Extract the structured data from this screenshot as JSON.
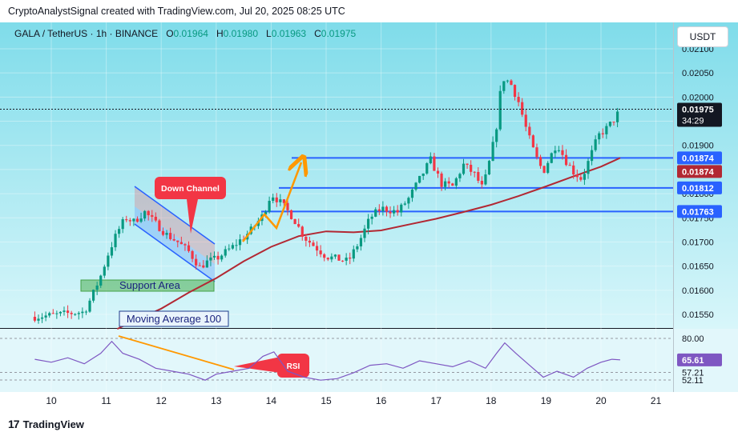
{
  "header": {
    "attribution": "CryptoAnalystSignal created with TradingView.com, Jul 20, 2025 08:25 UTC"
  },
  "legend": {
    "symbol": "GALA / TetherUS · 1h · BINANCE",
    "open_label": "O",
    "open": "0.01964",
    "high_label": "H",
    "high": "0.01980",
    "low_label": "L",
    "low": "0.01963",
    "close_label": "C",
    "close": "0.01975"
  },
  "currency_button": "USDT",
  "footer": {
    "brand": "TradingView"
  },
  "colors": {
    "up": "#089981",
    "down": "#f23645",
    "ma": "#b22833",
    "level_line": "#2962ff",
    "rsi": "#7e57c2",
    "annotation_orange": "#ff9800",
    "bg_top": "#7fdcea",
    "bg_bottom": "#d8f6fa"
  },
  "annotations": {
    "down_channel": "Down Channel",
    "support_area": "Support Area",
    "moving_average": "Moving Average 100",
    "rsi": "RSI"
  },
  "chart_data": [
    {
      "type": "candlestick",
      "title": "GALA / TetherUS · 1h · BINANCE",
      "x_axis": {
        "labels": [
          "10",
          "11",
          "12",
          "13",
          "14",
          "15",
          "16",
          "17",
          "18",
          "19",
          "20",
          "21"
        ],
        "unit": "day of July 2025"
      },
      "y_axis": {
        "range": [
          0.0152,
          0.0211
        ],
        "tick_labels": [
          "0.02100",
          "0.02050",
          "0.02000",
          "0.01950",
          "0.01900",
          "0.01850",
          "0.01800",
          "0.01750",
          "0.01700",
          "0.01650",
          "0.01600",
          "0.01550"
        ]
      },
      "price_labels": [
        {
          "value": "0.01975",
          "note": "last price",
          "countdown": "34:29"
        },
        {
          "value": "0.01874",
          "note": "resistance line"
        },
        {
          "value": "0.01874",
          "note": "moving average 100"
        },
        {
          "value": "0.01812",
          "note": "horizontal level"
        },
        {
          "value": "0.01763",
          "note": "horizontal level"
        }
      ],
      "levels": [
        0.01874,
        0.01812,
        0.01763
      ],
      "series": [
        {
          "name": "Moving Average 100",
          "points": [
            {
              "x": 11.2,
              "y": 0.0152
            },
            {
              "x": 12.0,
              "y": 0.01562
            },
            {
              "x": 12.5,
              "y": 0.01595
            },
            {
              "x": 13.0,
              "y": 0.01625
            },
            {
              "x": 13.5,
              "y": 0.0166
            },
            {
              "x": 14.0,
              "y": 0.0169
            },
            {
              "x": 14.5,
              "y": 0.01712
            },
            {
              "x": 15.0,
              "y": 0.01722
            },
            {
              "x": 15.5,
              "y": 0.0172
            },
            {
              "x": 16.0,
              "y": 0.01724
            },
            {
              "x": 16.5,
              "y": 0.01736
            },
            {
              "x": 17.0,
              "y": 0.01748
            },
            {
              "x": 17.5,
              "y": 0.01762
            },
            {
              "x": 18.0,
              "y": 0.01777
            },
            {
              "x": 18.5,
              "y": 0.01795
            },
            {
              "x": 19.0,
              "y": 0.01815
            },
            {
              "x": 19.5,
              "y": 0.01836
            },
            {
              "x": 20.0,
              "y": 0.01856
            },
            {
              "x": 20.35,
              "y": 0.01874
            }
          ]
        },
        {
          "name": "Price (approx. close path)",
          "points": [
            {
              "x": 9.7,
              "y": 0.01545
            },
            {
              "x": 10.0,
              "y": 0.01548
            },
            {
              "x": 10.3,
              "y": 0.01552
            },
            {
              "x": 10.6,
              "y": 0.01555
            },
            {
              "x": 10.75,
              "y": 0.0159
            },
            {
              "x": 10.9,
              "y": 0.0163
            },
            {
              "x": 11.05,
              "y": 0.0168
            },
            {
              "x": 11.2,
              "y": 0.0172
            },
            {
              "x": 11.35,
              "y": 0.0175
            },
            {
              "x": 11.5,
              "y": 0.01742
            },
            {
              "x": 11.7,
              "y": 0.01762
            },
            {
              "x": 11.9,
              "y": 0.01738
            },
            {
              "x": 12.1,
              "y": 0.01715
            },
            {
              "x": 12.3,
              "y": 0.017
            },
            {
              "x": 12.5,
              "y": 0.0168
            },
            {
              "x": 12.7,
              "y": 0.01648
            },
            {
              "x": 12.85,
              "y": 0.0166
            },
            {
              "x": 13.0,
              "y": 0.01665
            },
            {
              "x": 13.3,
              "y": 0.0169
            },
            {
              "x": 13.6,
              "y": 0.0172
            },
            {
              "x": 13.85,
              "y": 0.01755
            },
            {
              "x": 14.0,
              "y": 0.018
            },
            {
              "x": 14.2,
              "y": 0.01778
            },
            {
              "x": 14.4,
              "y": 0.0175
            },
            {
              "x": 14.6,
              "y": 0.0171
            },
            {
              "x": 14.8,
              "y": 0.0169
            },
            {
              "x": 15.0,
              "y": 0.0167
            },
            {
              "x": 15.2,
              "y": 0.01665
            },
            {
              "x": 15.4,
              "y": 0.0166
            },
            {
              "x": 15.6,
              "y": 0.017
            },
            {
              "x": 15.8,
              "y": 0.0175
            },
            {
              "x": 16.0,
              "y": 0.0177
            },
            {
              "x": 16.3,
              "y": 0.01762
            },
            {
              "x": 16.5,
              "y": 0.0179
            },
            {
              "x": 16.7,
              "y": 0.0183
            },
            {
              "x": 16.9,
              "y": 0.0187
            },
            {
              "x": 17.1,
              "y": 0.0182
            },
            {
              "x": 17.3,
              "y": 0.01815
            },
            {
              "x": 17.5,
              "y": 0.0186
            },
            {
              "x": 17.7,
              "y": 0.0184
            },
            {
              "x": 17.85,
              "y": 0.0181
            },
            {
              "x": 18.0,
              "y": 0.0188
            },
            {
              "x": 18.1,
              "y": 0.0194
            },
            {
              "x": 18.2,
              "y": 0.0204
            },
            {
              "x": 18.35,
              "y": 0.0203
            },
            {
              "x": 18.5,
              "y": 0.0199
            },
            {
              "x": 18.65,
              "y": 0.0193
            },
            {
              "x": 18.8,
              "y": 0.0188
            },
            {
              "x": 18.95,
              "y": 0.01845
            },
            {
              "x": 19.05,
              "y": 0.0187
            },
            {
              "x": 19.2,
              "y": 0.01905
            },
            {
              "x": 19.35,
              "y": 0.0187
            },
            {
              "x": 19.5,
              "y": 0.01845
            },
            {
              "x": 19.65,
              "y": 0.0183
            },
            {
              "x": 19.8,
              "y": 0.01875
            },
            {
              "x": 19.95,
              "y": 0.0192
            },
            {
              "x": 20.1,
              "y": 0.01935
            },
            {
              "x": 20.25,
              "y": 0.01955
            },
            {
              "x": 20.35,
              "y": 0.01975
            }
          ]
        }
      ]
    },
    {
      "type": "line",
      "title": "RSI",
      "y_axis": {
        "tick_labels": [
          "80.00",
          "57.21",
          "52.11"
        ],
        "current_label": "65.61"
      },
      "series": [
        {
          "name": "RSI",
          "points": [
            {
              "x": 9.7,
              "y": 66
            },
            {
              "x": 10.0,
              "y": 64
            },
            {
              "x": 10.3,
              "y": 67
            },
            {
              "x": 10.6,
              "y": 63
            },
            {
              "x": 10.9,
              "y": 70
            },
            {
              "x": 11.1,
              "y": 78
            },
            {
              "x": 11.3,
              "y": 70
            },
            {
              "x": 11.6,
              "y": 66
            },
            {
              "x": 11.9,
              "y": 60
            },
            {
              "x": 12.2,
              "y": 58
            },
            {
              "x": 12.5,
              "y": 56
            },
            {
              "x": 12.8,
              "y": 52
            },
            {
              "x": 13.0,
              "y": 56
            },
            {
              "x": 13.3,
              "y": 58
            },
            {
              "x": 13.6,
              "y": 60
            },
            {
              "x": 13.85,
              "y": 68
            },
            {
              "x": 14.05,
              "y": 71
            },
            {
              "x": 14.3,
              "y": 58
            },
            {
              "x": 14.6,
              "y": 54
            },
            {
              "x": 14.9,
              "y": 52
            },
            {
              "x": 15.2,
              "y": 53
            },
            {
              "x": 15.5,
              "y": 57
            },
            {
              "x": 15.8,
              "y": 62
            },
            {
              "x": 16.1,
              "y": 63
            },
            {
              "x": 16.4,
              "y": 60
            },
            {
              "x": 16.7,
              "y": 65
            },
            {
              "x": 17.0,
              "y": 63
            },
            {
              "x": 17.3,
              "y": 61
            },
            {
              "x": 17.6,
              "y": 65
            },
            {
              "x": 17.9,
              "y": 60
            },
            {
              "x": 18.1,
              "y": 70
            },
            {
              "x": 18.25,
              "y": 77
            },
            {
              "x": 18.45,
              "y": 70
            },
            {
              "x": 18.7,
              "y": 62
            },
            {
              "x": 18.95,
              "y": 54
            },
            {
              "x": 19.2,
              "y": 58
            },
            {
              "x": 19.5,
              "y": 54
            },
            {
              "x": 19.75,
              "y": 60
            },
            {
              "x": 20.0,
              "y": 64
            },
            {
              "x": 20.2,
              "y": 66
            },
            {
              "x": 20.35,
              "y": 65.61
            }
          ]
        }
      ]
    }
  ]
}
